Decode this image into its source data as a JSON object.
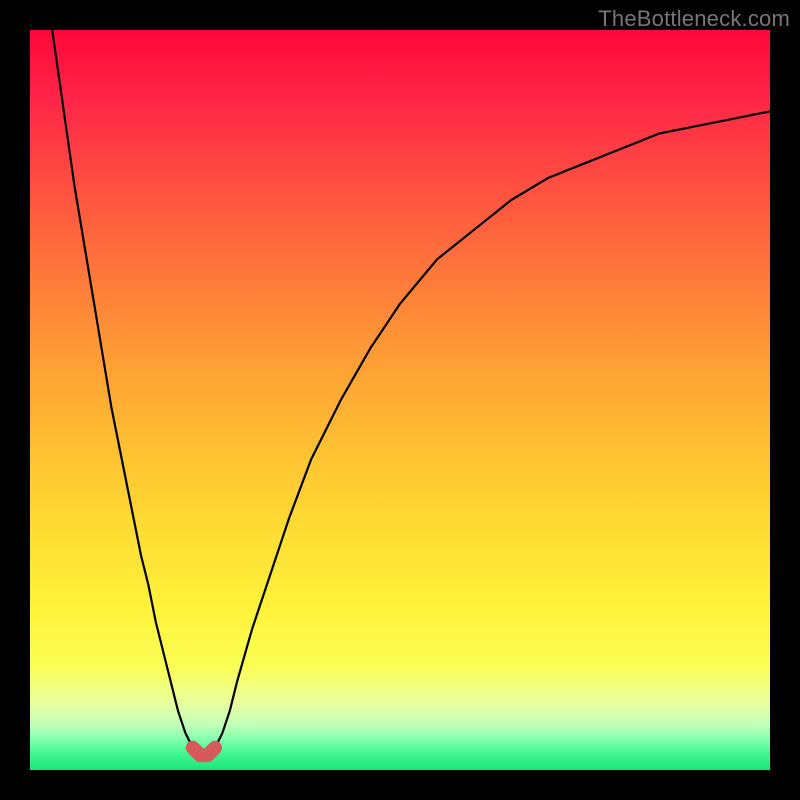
{
  "watermark": "TheBottleneck.com",
  "chart_data": {
    "type": "line",
    "title": "",
    "xlabel": "",
    "ylabel": "",
    "xlim": [
      0,
      100
    ],
    "ylim": [
      0,
      100
    ],
    "series": [
      {
        "name": "bottleneck-curve",
        "x": [
          3,
          4,
          5,
          6,
          7,
          8,
          9,
          10,
          11,
          12,
          13,
          14,
          15,
          16,
          17,
          18,
          19,
          20,
          21,
          22,
          23,
          24,
          25,
          26,
          27,
          28,
          30,
          32,
          35,
          38,
          42,
          46,
          50,
          55,
          60,
          65,
          70,
          75,
          80,
          85,
          90,
          95,
          100
        ],
        "values": [
          100,
          93,
          86,
          79,
          73,
          67,
          61,
          55,
          49,
          44,
          39,
          34,
          29,
          25,
          20,
          16,
          12,
          8,
          5,
          3,
          2,
          2,
          3,
          5,
          8,
          12,
          19,
          25,
          34,
          42,
          50,
          57,
          63,
          69,
          73,
          77,
          80,
          82,
          84,
          86,
          87,
          88,
          89
        ]
      }
    ],
    "marker": {
      "name": "optimal-region",
      "x": [
        22,
        23,
        24,
        25
      ],
      "values": [
        3,
        2,
        2,
        3
      ]
    }
  }
}
